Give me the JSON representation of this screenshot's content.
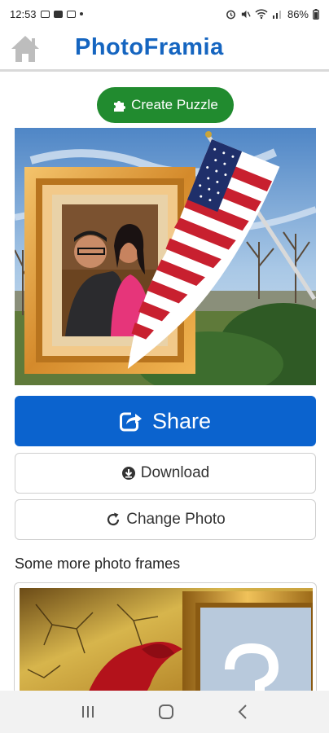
{
  "status_bar": {
    "time": "12:53",
    "battery": "86%"
  },
  "header": {
    "logo_main": "PhotoFrami",
    "logo_tail": "a"
  },
  "actions": {
    "create_puzzle_label": "Create Puzzle",
    "share_label": "Share",
    "download_label": "Download",
    "change_photo_label": "Change Photo"
  },
  "more_frames": {
    "heading": "Some more photo frames"
  },
  "colors": {
    "brand_blue": "#1565c0",
    "share_blue": "#0b63ce",
    "puzzle_green": "#218b2f"
  },
  "icons": {
    "home": "home-icon",
    "puzzle": "puzzle-piece-icon",
    "share": "share-icon",
    "download": "download-icon",
    "refresh": "refresh-icon"
  }
}
